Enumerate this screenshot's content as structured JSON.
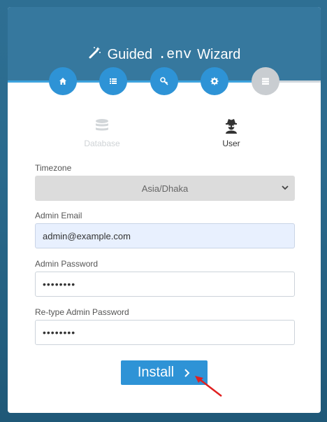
{
  "header": {
    "title_prefix": "Guided",
    "title_mono": ".env",
    "title_suffix": "Wizard",
    "icon": "magic-wand-icon"
  },
  "steps": [
    {
      "icon": "home-icon",
      "active": true
    },
    {
      "icon": "list-icon",
      "active": true
    },
    {
      "icon": "key-icon",
      "active": true
    },
    {
      "icon": "gear-icon",
      "active": true
    },
    {
      "icon": "server-icon",
      "active": false
    }
  ],
  "tabs": {
    "database": "Database",
    "user": "User"
  },
  "form": {
    "timezone_label": "Timezone",
    "timezone_value": "Asia/Dhaka",
    "email_label": "Admin Email",
    "email_value": "admin@example.com",
    "password_label": "Admin Password",
    "password_value": "••••••••",
    "retype_label": "Re-type Admin Password",
    "retype_value": "••••••••"
  },
  "install_button": "Install",
  "colors": {
    "header": "#36789e",
    "accent": "#2e93d6",
    "annotation_arrow": "#e02020"
  }
}
